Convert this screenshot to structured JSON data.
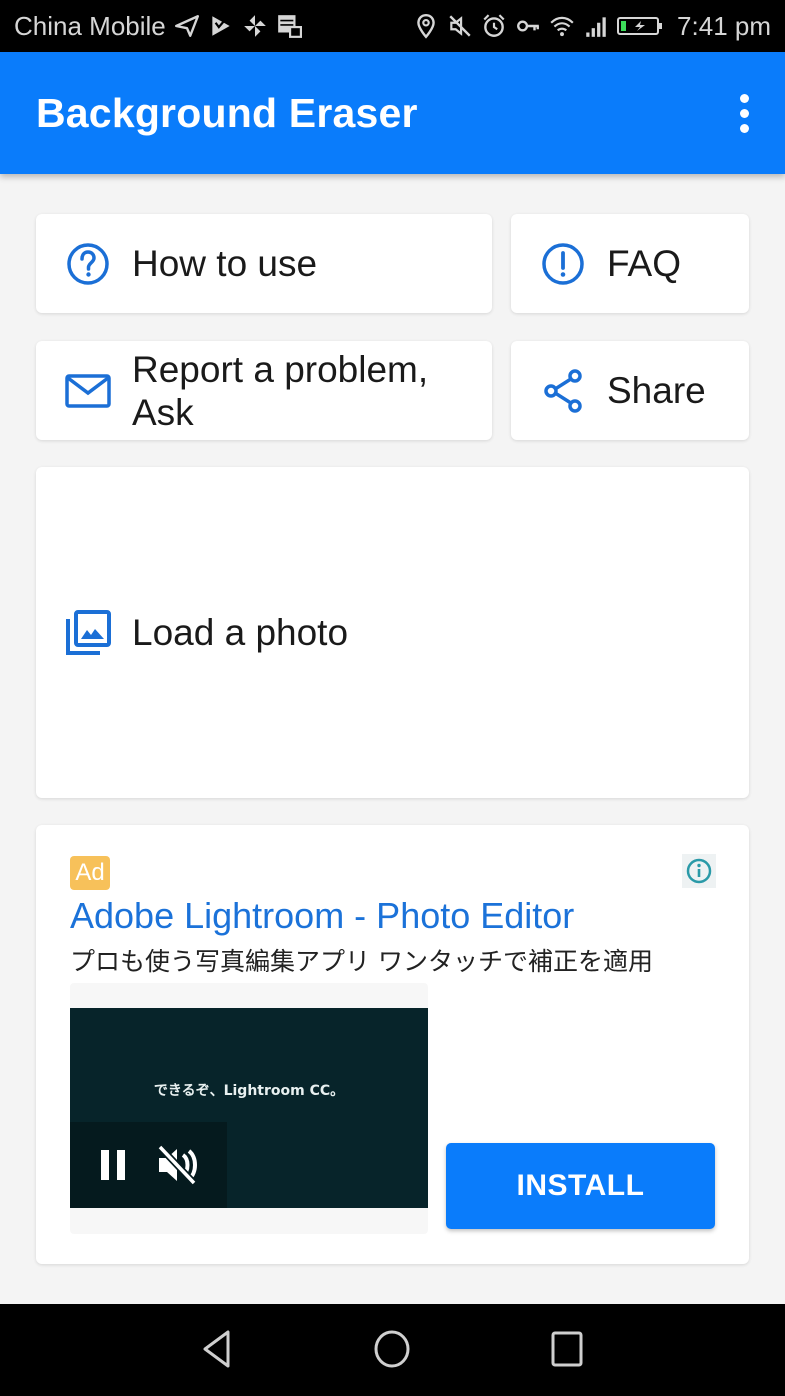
{
  "status_bar": {
    "carrier": "China Mobile",
    "left_icons": [
      "send-icon",
      "check-flag-icon",
      "pinwheel-icon",
      "stack-notification-icon"
    ],
    "right_icons": [
      "location-icon",
      "mute-icon",
      "alarm-icon",
      "vpn-key-icon",
      "wifi-icon",
      "signal-icon",
      "battery-charging-icon"
    ],
    "time": "7:41 pm"
  },
  "app_bar": {
    "title": "Background Eraser",
    "menu_icon": "more-vertical-icon"
  },
  "menu": {
    "how_to_use": {
      "label": "How to use",
      "icon": "help-circle-icon"
    },
    "faq": {
      "label": "FAQ",
      "icon": "alert-circle-icon"
    },
    "report": {
      "label": "Report a problem, Ask",
      "line1": "Report a problem,",
      "line2": "Ask",
      "icon": "mail-icon"
    },
    "share": {
      "label": "Share",
      "icon": "share-icon"
    },
    "load_photo": {
      "label": "Load a photo",
      "icon": "photo-library-icon"
    }
  },
  "ad": {
    "badge": "Ad",
    "info_icon": "info-icon",
    "title": "Adobe Lightroom - Photo Editor",
    "description": "プロも使う写真編集アプリ ワンタッチで補正を適用",
    "video_caption": "できるぞ、Lightroom CC。",
    "video_controls": [
      "pause-icon",
      "volume-off-icon"
    ],
    "cta": "INSTALL"
  },
  "nav_bar": {
    "buttons": [
      "back-icon",
      "home-icon",
      "recents-icon"
    ]
  },
  "colors": {
    "primary": "#0a7cfb",
    "icon_blue": "#1b6fd6",
    "background": "#f4f4f4",
    "ad_badge": "#f7c15a",
    "ad_title": "#1b72d9",
    "info_teal": "#2a9aa8",
    "video_bg": "#07242a"
  }
}
